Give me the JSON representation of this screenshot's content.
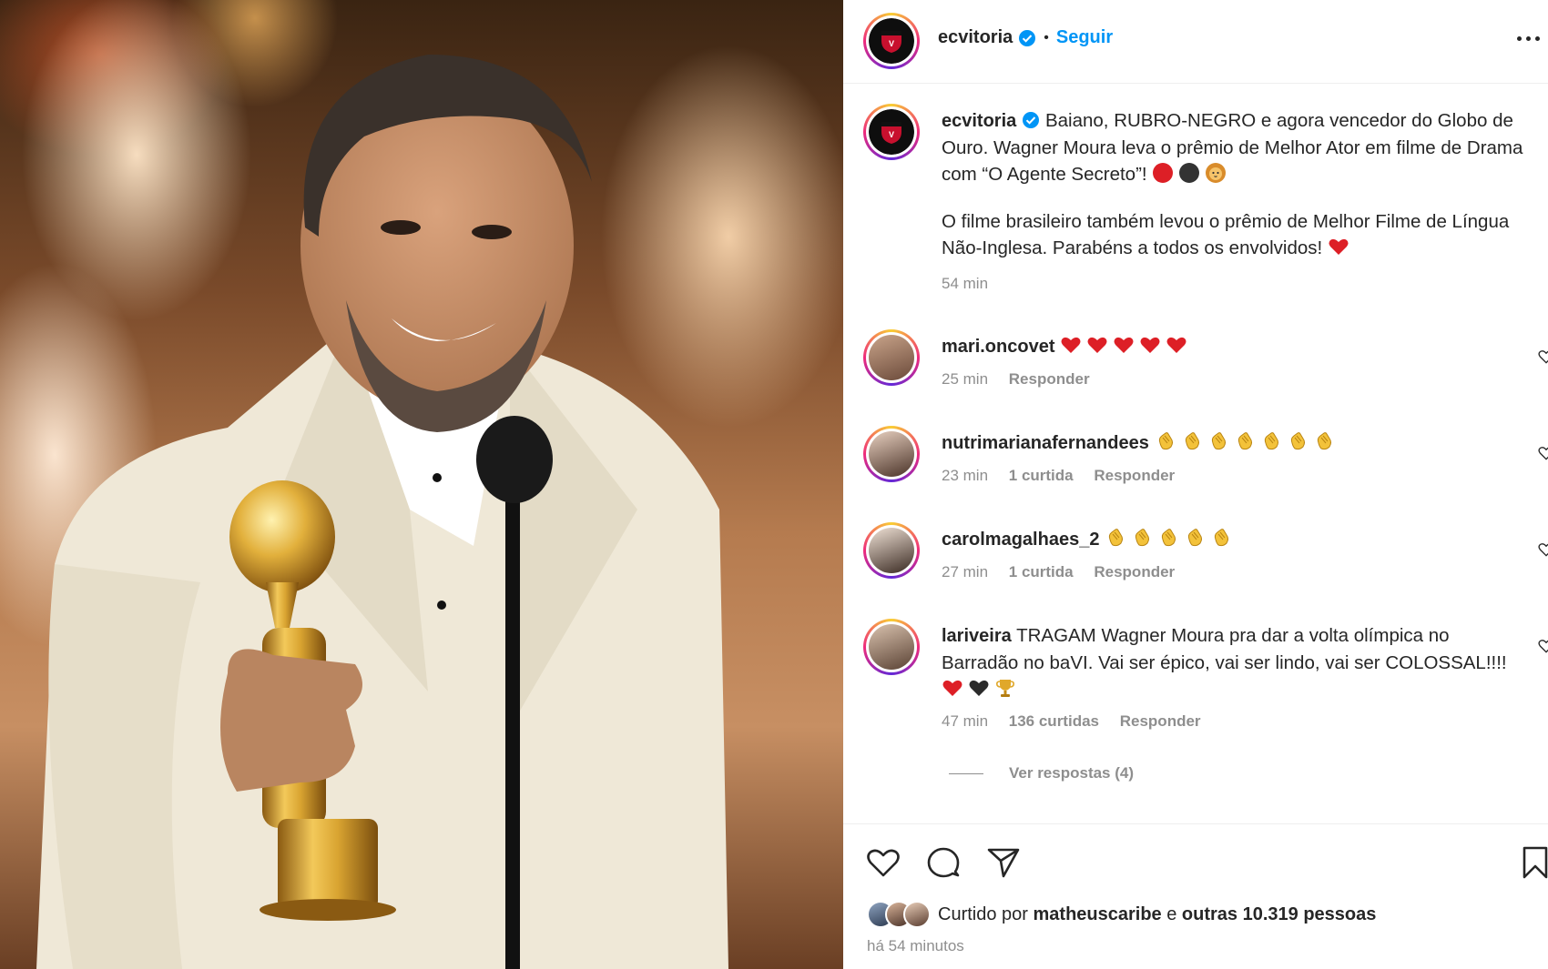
{
  "post": {
    "author": "ecvitoria",
    "follow_label": "Seguir",
    "separator": "•",
    "caption_p1": "Baiano, RUBRO-NEGRO e agora vencedor do Globo de Ouro. Wagner Moura leva o prêmio de Melhor Ator em filme de Drama com “O Agente Secreto”!",
    "caption_p2": "O filme brasileiro também levou o prêmio de Melhor Filme de Língua Não-Inglesa. Parabéns a todos os envolvidos!",
    "caption_time": "54 min"
  },
  "comments": [
    {
      "user": "mari.oncovet",
      "text": "",
      "emoji": [
        "red-heart",
        "red-heart",
        "red-heart",
        "red-heart",
        "red-heart"
      ],
      "time": "25 min",
      "likes": "",
      "reply": "Responder"
    },
    {
      "user": "nutrimarianafernandees",
      "text": "",
      "emoji": [
        "clap",
        "clap",
        "clap",
        "clap",
        "clap",
        "clap",
        "clap"
      ],
      "time": "23 min",
      "likes": "1 curtida",
      "reply": "Responder"
    },
    {
      "user": "carolmagalhaes_2",
      "text": "",
      "emoji": [
        "clap",
        "clap",
        "clap",
        "clap",
        "clap"
      ],
      "time": "27 min",
      "likes": "1 curtida",
      "reply": "Responder"
    },
    {
      "user": "lariveira",
      "text": "TRAGAM Wagner Moura pra dar a volta olímpica no Barradão no baVI. Vai ser épico, vai ser lindo, vai ser COLOSSAL!!!!",
      "emoji": [
        "red-heart",
        "black-heart",
        "trophy"
      ],
      "time": "47 min",
      "likes": "136 curtidas",
      "reply": "Responder"
    }
  ],
  "view_replies": "Ver respostas (4)",
  "likes": {
    "prefix": "Curtido por",
    "user": "matheuscaribe",
    "middle": "e",
    "others": "outras 10.319 pessoas"
  },
  "post_time": "há 54 minutos",
  "colors": {
    "accent": "#0095f6",
    "verified": "#0095f6",
    "muted": "#8e8e8e",
    "text": "#262626"
  }
}
